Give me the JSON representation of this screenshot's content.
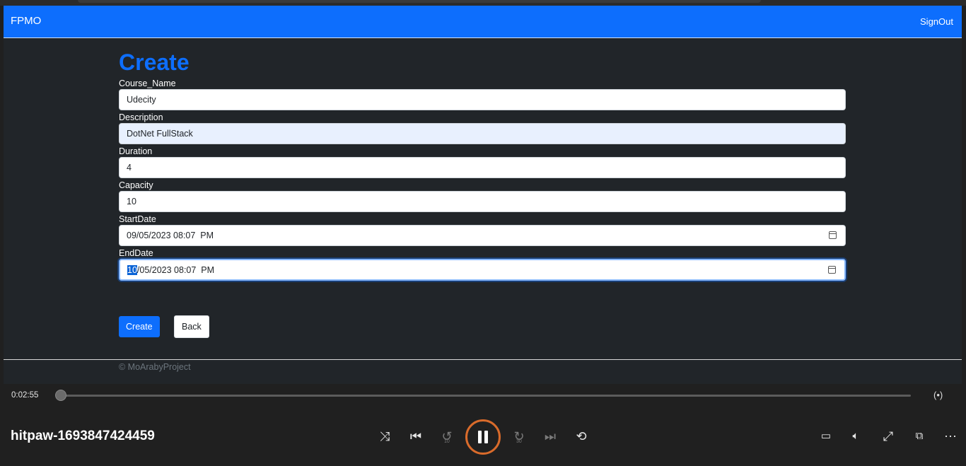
{
  "navbar": {
    "brand": "FPMO",
    "signout": "SignOut"
  },
  "form": {
    "title": "Create",
    "fields": [
      {
        "label": "Course_Name",
        "value": "Udecity"
      },
      {
        "label": "Description",
        "value": "DotNet FullStack"
      },
      {
        "label": "Duration",
        "value": "4"
      },
      {
        "label": "Capacity",
        "value": "10"
      },
      {
        "label": "StartDate",
        "value": "09/05/2023 08:07  PM"
      },
      {
        "label": "EndDate",
        "value_selected": "10",
        "value_rest": "/05/2023 08:07  PM"
      }
    ],
    "create_label": "Create",
    "back_label": "Back"
  },
  "footer": {
    "text": "© MoArabyProject"
  },
  "player": {
    "time": "0:02:55",
    "filename": "hitpaw-1693847424459",
    "progress_fraction": 0.0,
    "icons": [
      "cast-icon",
      "shuffle-icon",
      "previous-icon",
      "rewind-10-icon",
      "pause-icon",
      "forward-30-icon",
      "next-icon",
      "repeat-off-icon",
      "subtitles-icon",
      "volume-icon",
      "fullscreen-icon",
      "miniplayer-icon",
      "more-icon"
    ],
    "rewind_label": "10",
    "forward_label": "30"
  },
  "colors": {
    "accent": "#0d6efd",
    "background": "#212529",
    "player_ring": "#d96b2b"
  }
}
